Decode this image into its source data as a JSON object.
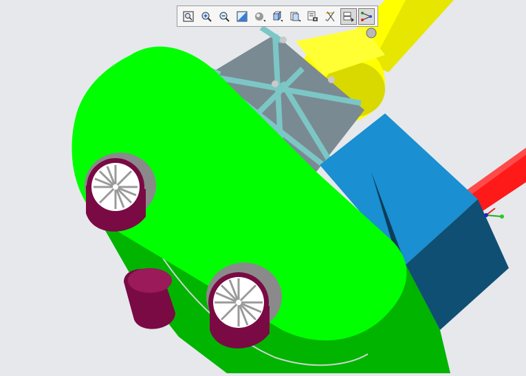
{
  "app": {
    "view": "3d-model-viewport"
  },
  "colors": {
    "background": "#e6e8ec",
    "body_light_green": "#00ff00",
    "body_dark_green": "#00b400",
    "wheel_rim": "#7a0a44",
    "wheel_tire": "#8a8a8a",
    "block_blue_light": "#1a8fd1",
    "block_blue_dark": "#0f4f73",
    "arm_yellow": "#ffff00",
    "pipe_red": "#ff1a1a",
    "frame_cyan": "#8fd3d3"
  },
  "toolbar": {
    "buttons": [
      {
        "icon": "zoom-fit-icon",
        "active": false
      },
      {
        "icon": "zoom-in-icon",
        "active": false
      },
      {
        "icon": "zoom-out-icon",
        "active": false
      },
      {
        "icon": "repaint-icon",
        "active": false
      },
      {
        "icon": "shading-icon",
        "active": false
      },
      {
        "icon": "view-cube-icon",
        "active": false
      },
      {
        "icon": "saved-views-icon",
        "active": false
      },
      {
        "icon": "layers-icon",
        "active": false
      },
      {
        "icon": "datum-display-icon",
        "active": false
      },
      {
        "icon": "spin-center-icon",
        "active": true
      },
      {
        "icon": "annotation-icon",
        "active": true
      }
    ]
  }
}
